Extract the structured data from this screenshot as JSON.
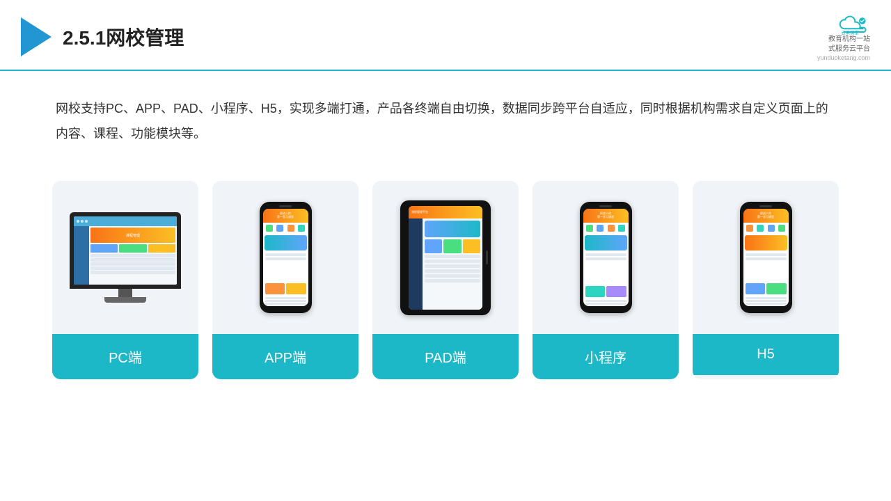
{
  "header": {
    "title": "2.5.1网校管理",
    "brand_name": "云朵课堂",
    "brand_url": "yunduoketang.com",
    "brand_tagline": "教育机构一站\n式服务云平台"
  },
  "description": {
    "text": "网校支持PC、APP、PAD、小程序、H5，实现多端打通，产品各终端自由切换，数据同步跨平台自适应，同时根据机构需求自定义页面上的内容、课程、功能模块等。"
  },
  "cards": [
    {
      "id": "pc",
      "label": "PC端"
    },
    {
      "id": "app",
      "label": "APP端"
    },
    {
      "id": "pad",
      "label": "PAD端"
    },
    {
      "id": "miniprogram",
      "label": "小程序"
    },
    {
      "id": "h5",
      "label": "H5"
    }
  ],
  "colors": {
    "accent": "#1db8c8",
    "header_border": "#1db8c8",
    "triangle": "#2196d3",
    "card_label_bg": "#1db8c8",
    "card_bg": "#f0f4f8"
  }
}
